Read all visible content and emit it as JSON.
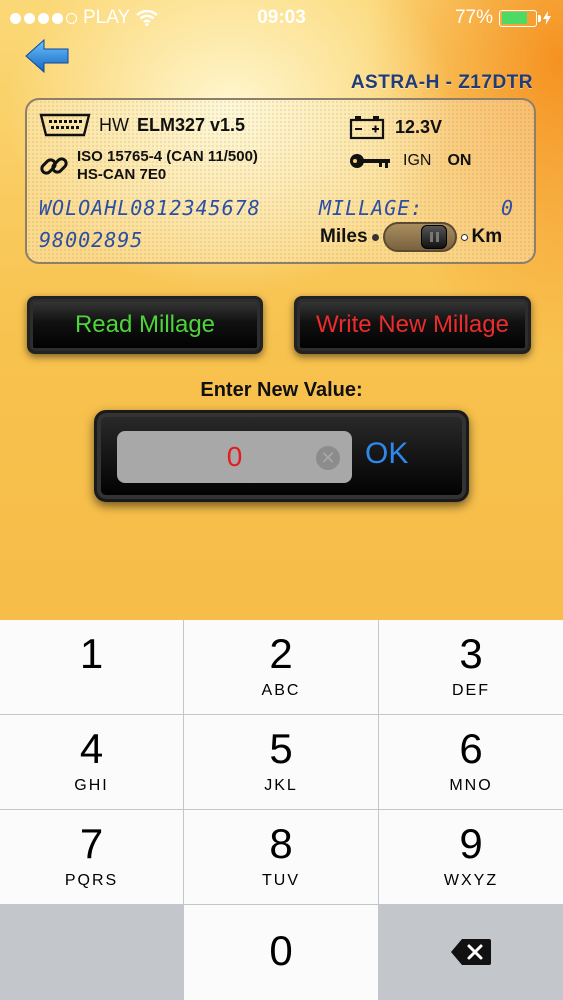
{
  "status_bar": {
    "carrier": "PLAY",
    "time": "09:03",
    "battery": "77%",
    "battery_level": 0.77,
    "icons": [
      "signal-dots-icon",
      "wifi-icon",
      "battery-icon",
      "charging-bolt-icon"
    ]
  },
  "header": {
    "back_icon": "back-arrow-icon",
    "vehicle_model": "ASTRA-H - Z17DTR"
  },
  "info": {
    "hw_label": "HW",
    "hw_value": "ELM327 v1.5",
    "voltage": "12.3V",
    "protocol_line1": "ISO 15765-4 (CAN 11/500)",
    "protocol_line2": "HS-CAN  7E0",
    "ign_label": "IGN",
    "ign_value": "ON",
    "vin": "WOLOAHL0812345678",
    "millage_label": "MILLAGE:",
    "millage_value": "0",
    "serial": "98002895",
    "unit_left": "Miles",
    "unit_right": "Km",
    "unit_selected": "Km",
    "colors": {
      "lcd_text": "#2c4fa6"
    }
  },
  "actions": {
    "read_label": "Read Millage",
    "write_label": "Write New Millage",
    "colors": {
      "read": "#4ed33b",
      "write": "#ec2c2c"
    }
  },
  "entry": {
    "prompt": "Enter New Value:",
    "value": "0",
    "ok_label": "OK",
    "colors": {
      "value": "#e31d1d",
      "ok": "#2c89ee"
    }
  },
  "keypad": {
    "keys": [
      {
        "num": "1",
        "letters": ""
      },
      {
        "num": "2",
        "letters": "ABC"
      },
      {
        "num": "3",
        "letters": "DEF"
      },
      {
        "num": "4",
        "letters": "GHI"
      },
      {
        "num": "5",
        "letters": "JKL"
      },
      {
        "num": "6",
        "letters": "MNO"
      },
      {
        "num": "7",
        "letters": "PQRS"
      },
      {
        "num": "8",
        "letters": "TUV"
      },
      {
        "num": "9",
        "letters": "WXYZ"
      },
      {
        "num": "0",
        "letters": ""
      }
    ],
    "delete_icon": "backspace-icon"
  }
}
